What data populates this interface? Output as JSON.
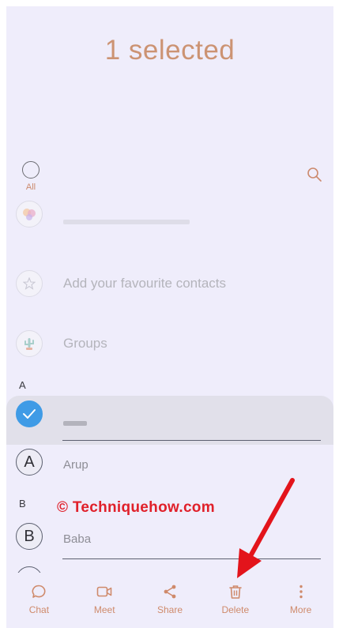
{
  "header": {
    "title": "1 selected"
  },
  "toolbar": {
    "select_all_label": "All"
  },
  "list": {
    "items": [
      {
        "label": "Add your favourite contacts"
      },
      {
        "label": "Groups"
      }
    ],
    "sections": [
      {
        "letter": "A"
      },
      {
        "letter": "B"
      }
    ],
    "contacts": [
      {
        "initial": "A",
        "name": "Arup"
      },
      {
        "initial": "B",
        "name": "Baba"
      }
    ]
  },
  "watermark": {
    "text": "© Techniquehow.com"
  },
  "bottom_bar": {
    "items": [
      {
        "label": "Chat",
        "icon": "chat-icon"
      },
      {
        "label": "Meet",
        "icon": "video-icon"
      },
      {
        "label": "Share",
        "icon": "share-icon"
      },
      {
        "label": "Delete",
        "icon": "trash-icon"
      },
      {
        "label": "More",
        "icon": "more-vertical-icon"
      }
    ]
  },
  "colors": {
    "accent": "#cc9373",
    "background": "#efedfb",
    "selected_check": "#3f9be6",
    "annotation": "#e0202a"
  }
}
